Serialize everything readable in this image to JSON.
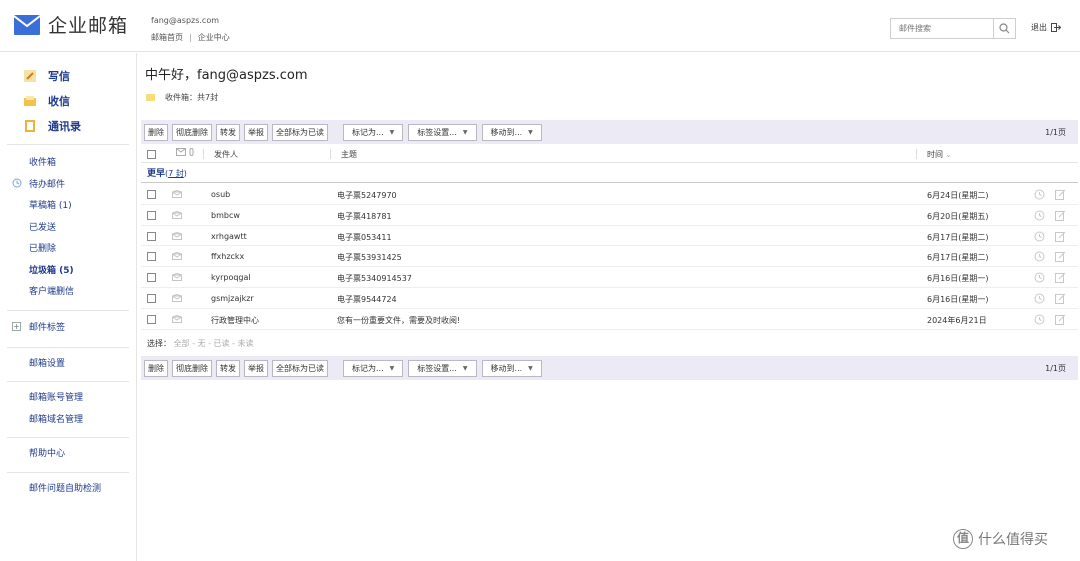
{
  "header": {
    "logo_text": "企业邮箱",
    "user_email": "fang@aspzs.com",
    "link_home": "邮箱首页",
    "link_sep": "|",
    "link_center": "企业中心",
    "search_placeholder": "邮件搜索",
    "logout": "退出"
  },
  "sidebar": {
    "compose": "写信",
    "receive": "收信",
    "contacts": "通讯录",
    "folders": [
      {
        "label": "收件箱",
        "bold": false
      },
      {
        "label": "待办邮件",
        "bold": false
      },
      {
        "label": "草稿箱 (1)",
        "bold": false
      },
      {
        "label": "已发送",
        "bold": false
      },
      {
        "label": "已删除",
        "bold": false
      },
      {
        "label": "垃圾箱 (5)",
        "bold": true
      },
      {
        "label": "客户端删信",
        "bold": false
      }
    ],
    "tags": "邮件标签",
    "settings": "邮箱设置",
    "account_mgmt": "邮箱账号管理",
    "domain_mgmt": "邮箱域名管理",
    "help": "帮助中心",
    "self_check": "邮件问题自助检测"
  },
  "main": {
    "greeting": "中午好，fang@aspzs.com",
    "inbox_count": "收件箱：共7封",
    "toolbar": {
      "delete": "删除",
      "perm_delete": "彻底删除",
      "forward": "转发",
      "report": "举报",
      "mark_all_read": "全部标为已读",
      "mark_as": "标记为...",
      "tag_settings": "标签设置...",
      "move_to": "移动到...",
      "pager": "1/1页"
    },
    "columns": {
      "sender": "发件人",
      "subject": "主题",
      "time": "时间"
    },
    "group": {
      "label": "更早",
      "count_open": "(",
      "count": "7 封",
      "count_close": ")"
    },
    "emails": [
      {
        "sender": "osub",
        "subject": "电子票5247970",
        "time": "6月24日(星期二)"
      },
      {
        "sender": "bmbcw",
        "subject": "电子票418781",
        "time": "6月20日(星期五)"
      },
      {
        "sender": "xrhgawtt",
        "subject": "电子票053411",
        "time": "6月17日(星期二)"
      },
      {
        "sender": "ffxhzckx",
        "subject": "电子票53931425",
        "time": "6月17日(星期二)"
      },
      {
        "sender": "kyrpoqgal",
        "subject": "电子票5340914537",
        "time": "6月16日(星期一)"
      },
      {
        "sender": "gsmjzajkzr",
        "subject": "电子票9544724",
        "time": "6月16日(星期一)"
      },
      {
        "sender": "行政管理中心",
        "subject": "您有一份重要文件，需要及时收阅!",
        "time": "2024年6月21日"
      }
    ],
    "select_bar": {
      "label": "选择：",
      "all": "全部",
      "none": "无",
      "read": "已读",
      "unread": "未读",
      "sep": " - "
    }
  },
  "watermark": {
    "badge": "值",
    "text": "什么值得买"
  }
}
